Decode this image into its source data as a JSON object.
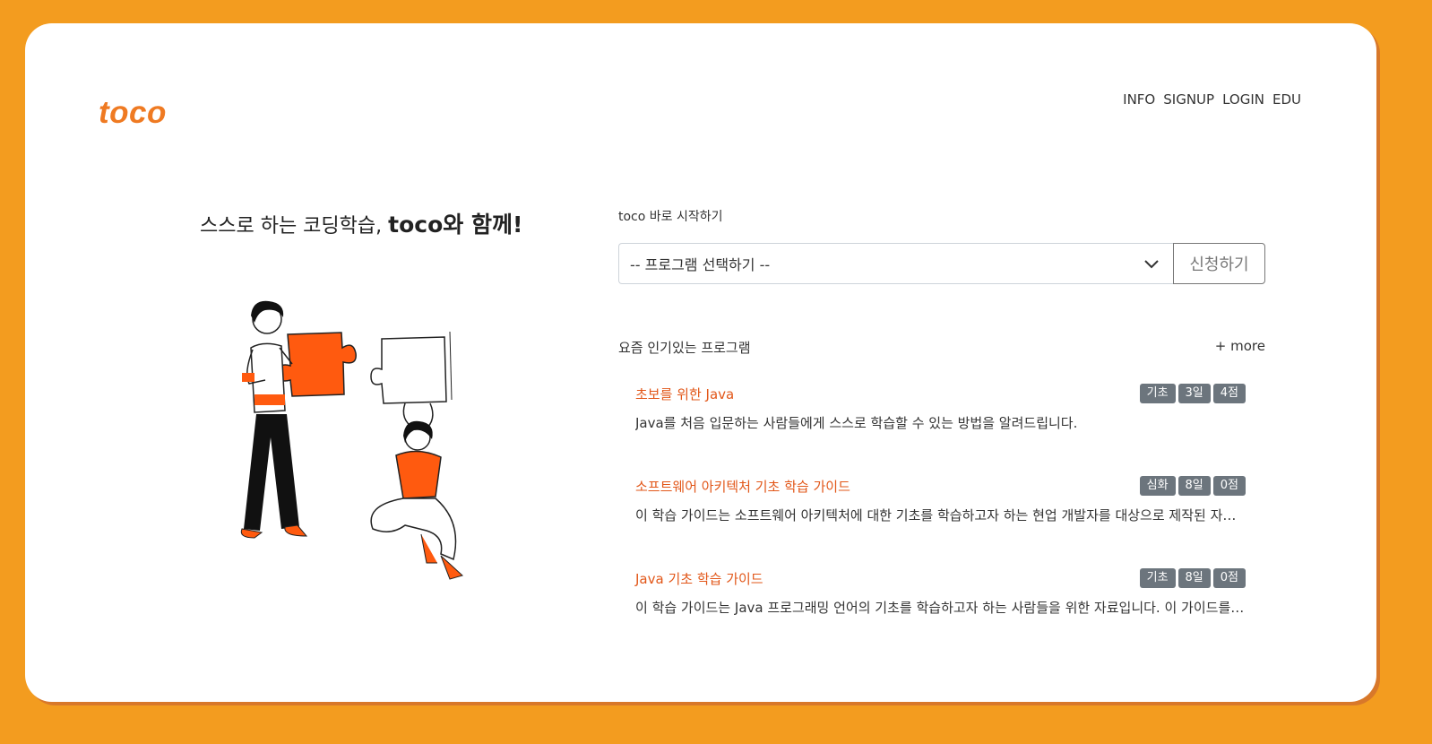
{
  "header": {
    "logo": "toco",
    "nav": [
      "INFO",
      "SIGNUP",
      "LOGIN",
      "EDU"
    ]
  },
  "hero": {
    "tagline_normal": "스스로 하는 코딩학습, ",
    "tagline_strong": "toco와 함께!"
  },
  "start": {
    "label": "toco 바로 시작하기",
    "select_value": "-- 프로그램 선택하기 --",
    "apply_label": "신청하기"
  },
  "popular": {
    "heading": "요즘 인기있는 프로그램",
    "more_label": "+ more",
    "programs": [
      {
        "title": "초보를 위한 Java",
        "badges": [
          "기초",
          "3일",
          "4점"
        ],
        "description": "Java를 처음 입문하는 사람들에게 스스로 학습할 수 있는 방법을 알려드립니다."
      },
      {
        "title": "소프트웨어 아키텍처 기초 학습 가이드",
        "badges": [
          "심화",
          "8일",
          "0점"
        ],
        "description": "이 학습 가이드는 소프트웨어 아키텍처에 대한 기초를 학습하고자 하는 현업 개발자를 대상으로 제작된 자료입니다."
      },
      {
        "title": "Java 기초 학습 가이드",
        "badges": [
          "기초",
          "8일",
          "0점"
        ],
        "description": "이 학습 가이드는 Java 프로그래밍 언어의 기초를 학습하고자 하는 사람들을 위한 자료입니다. 이 가이드를 통해"
      }
    ]
  },
  "colors": {
    "background": "#f39c1f",
    "brand": "#ef7a22",
    "program_title": "#e25719",
    "badge": "#6c757d"
  },
  "icons": {
    "select_arrow": "chevron-down-icon"
  }
}
